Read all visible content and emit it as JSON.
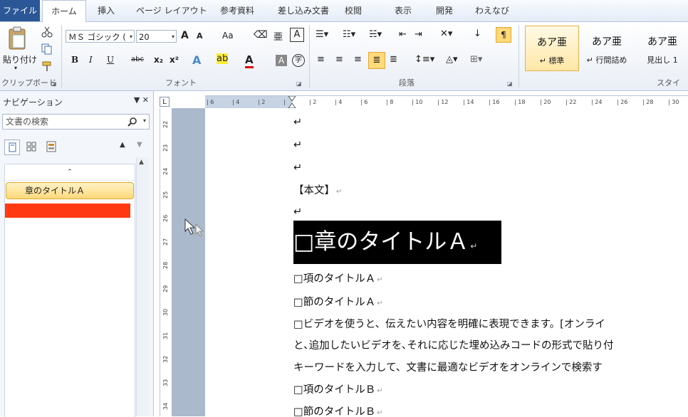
{
  "tabs": [
    "ファイル",
    "ホーム",
    "挿入",
    "ページ レイアウト",
    "参考資料",
    "差し込み文書",
    "校閲",
    "表示",
    "開発",
    "わえなび"
  ],
  "ribbon": {
    "clipboard": {
      "paste_label": "貼り付け",
      "group_label": "クリップボード"
    },
    "font": {
      "font_name": "ＭＳ ゴシック (",
      "font_size": "20",
      "group_label": "フォント",
      "bold": "B",
      "italic": "I",
      "underline": "U",
      "strike": "abc",
      "sub": "x₂",
      "sup": "x²",
      "grow": "A",
      "shrink": "A",
      "case": "Aa",
      "ruby": "亜",
      "border_char": "A",
      "enclose": "字"
    },
    "paragraph": {
      "group_label": "段落"
    },
    "styles": {
      "group_label": "スタイ",
      "items": [
        {
          "sample": "あア亜",
          "name": "↵ 標準"
        },
        {
          "sample": "あア亜",
          "name": "↵ 行間詰め"
        },
        {
          "sample": "あア亜",
          "name": "見出し 1"
        }
      ]
    }
  },
  "nav": {
    "title": "ナビゲーション",
    "controls": "▼ ✕",
    "search_placeholder": "文書の検索",
    "collapse_glyph": "⌃",
    "heading": "章のタイトルＡ"
  },
  "ruler": {
    "h_labels": [
      "6",
      "4",
      "2",
      "",
      "2",
      "4",
      "6",
      "8",
      "10",
      "12",
      "14",
      "16",
      "18",
      "20",
      "22",
      "24",
      "26",
      "28",
      "30"
    ],
    "v_labels": [
      "22",
      "23",
      "24",
      "25",
      "26",
      "27",
      "28",
      "29",
      "30",
      "31",
      "32",
      "33",
      "34"
    ],
    "corner": "L"
  },
  "document": {
    "empty_marks": [
      "↵",
      "↵",
      "↵"
    ],
    "body_label": "【本文】",
    "empty_after_label": "↵",
    "heading": "□章のタイトルＡ",
    "lines": [
      "□項のタイトルＡ",
      "□節のタイトルＡ",
      "□ビデオを使うと、伝えたい内容を明確に表現できます。[オンライ",
      "と､追加したいビデオを､それに応じた埋め込みコードの形式で貼り付",
      "キーワードを入力して、文書に最適なビデオをオンラインで検索す",
      "□項のタイトルＢ",
      "□節のタイトルＢ"
    ],
    "para_mark": "↵"
  },
  "colors": {
    "file_tab": "#2b5797",
    "nav_highlight": "#ffd97a",
    "nav_red": "#ff3a12",
    "heading_bg": "#000000"
  }
}
